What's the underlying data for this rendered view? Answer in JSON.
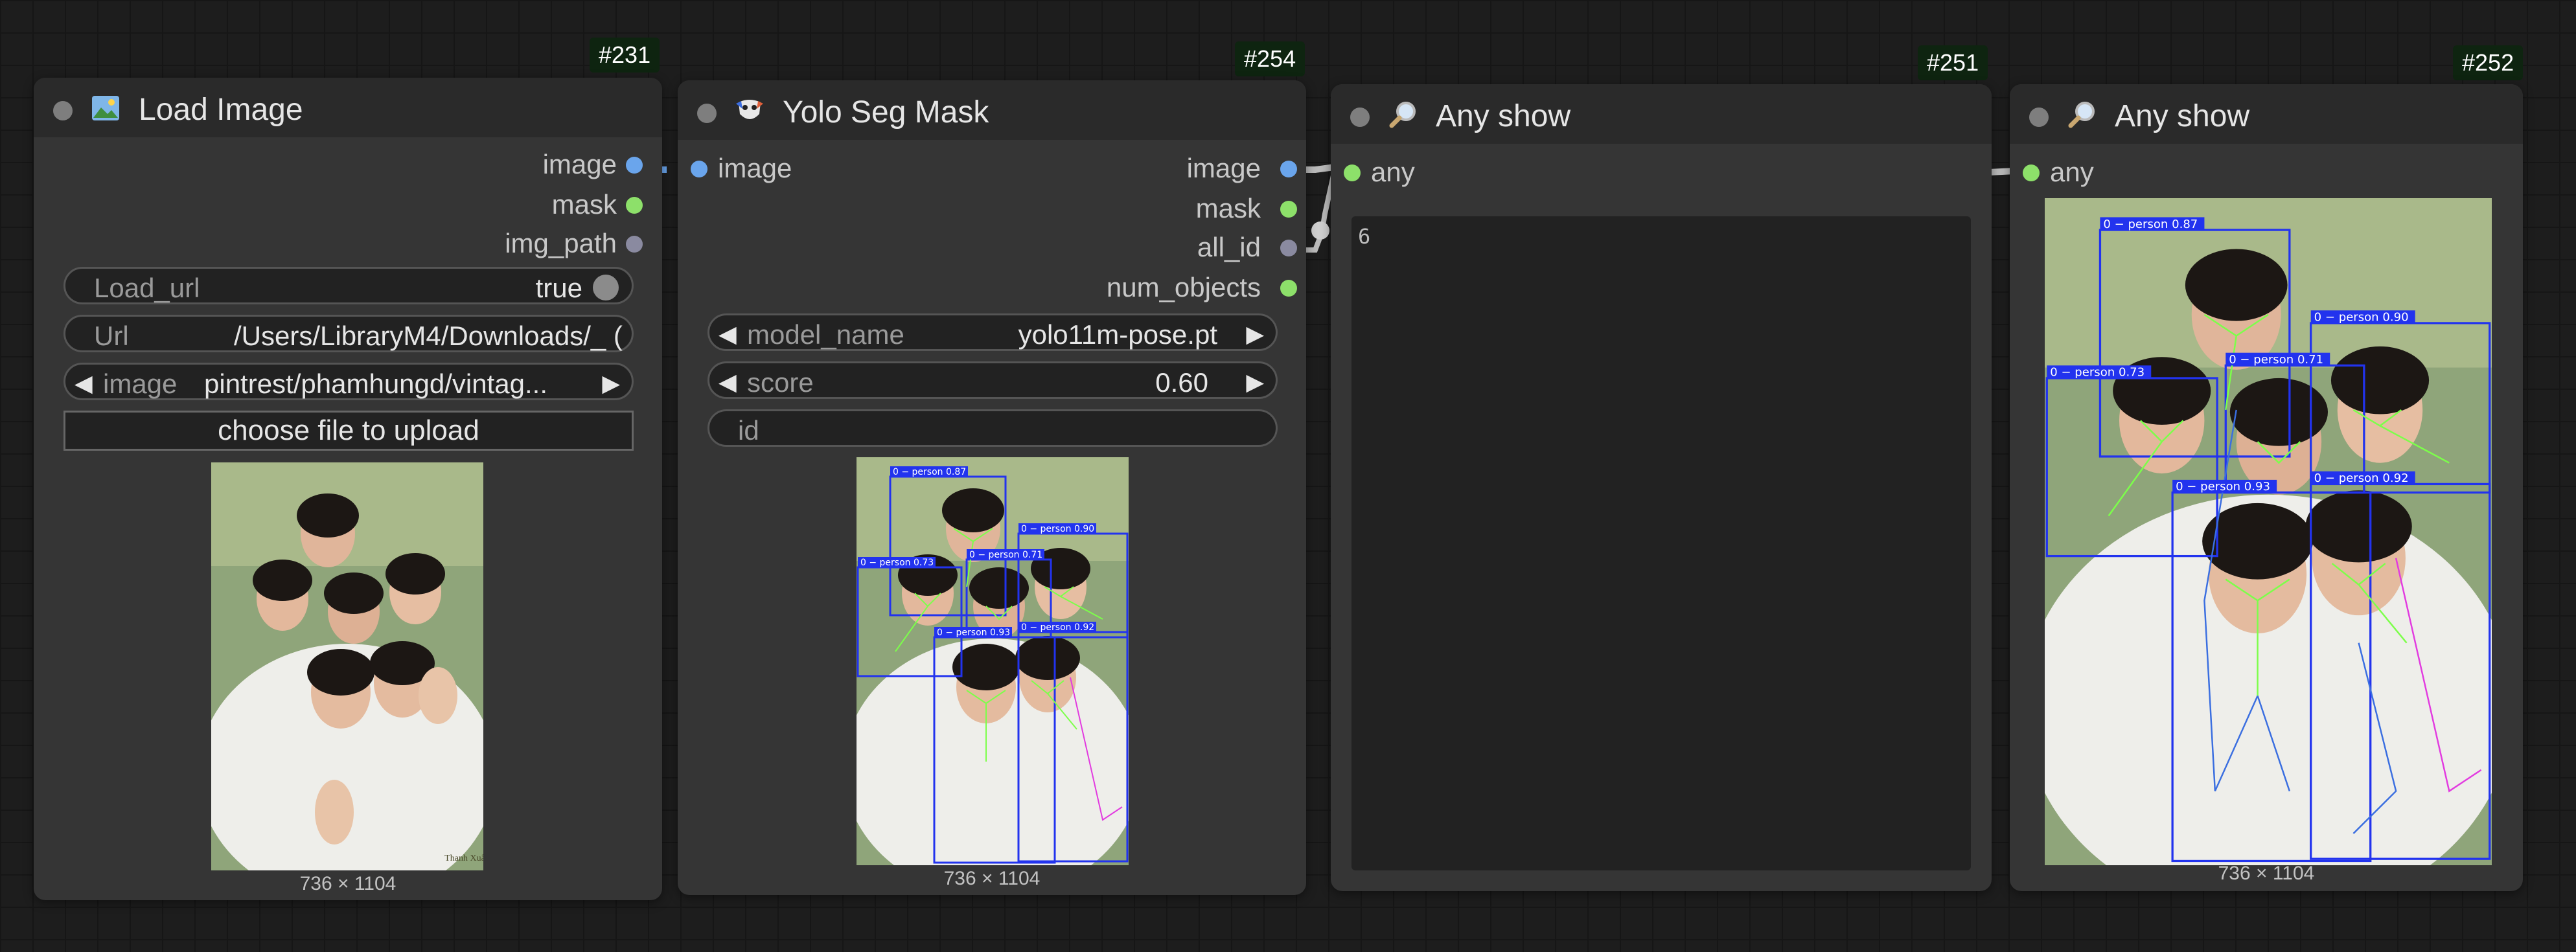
{
  "nodes": {
    "load_image": {
      "id": "#231",
      "title": "Load Image",
      "outputs": [
        "image",
        "mask",
        "img_path"
      ],
      "widgets": {
        "load_url": {
          "name": "Load_url",
          "value": "true"
        },
        "url": {
          "name": "Url",
          "value": "/Users/LibraryM4/Downloads/_ ("
        },
        "image": {
          "name": "image",
          "value": "pintrest/phamhungd/vintag..."
        }
      },
      "upload_button": "choose file to upload",
      "image_size": "736 × 1104"
    },
    "yolo_seg_mask": {
      "id": "#254",
      "title": "Yolo Seg Mask",
      "inputs": [
        "image"
      ],
      "outputs": [
        "image",
        "mask",
        "all_id",
        "num_objects"
      ],
      "widgets": {
        "model_name": {
          "name": "model_name",
          "value": "yolo11m-pose.pt"
        },
        "score": {
          "name": "score",
          "value": "0.60"
        },
        "id": {
          "name": "id",
          "value": ""
        }
      },
      "image_size": "736 × 1104"
    },
    "any_show_251": {
      "id": "#251",
      "title": "Any show",
      "inputs": [
        "any"
      ],
      "text_value": "6"
    },
    "any_show_252": {
      "id": "#252",
      "title": "Any show",
      "inputs": [
        "any"
      ],
      "image_size": "736 × 1104"
    }
  },
  "detections": [
    {
      "label": "0 − person 0.87"
    },
    {
      "label": "0 − person 0.90"
    },
    {
      "label": "0 − person 0.71"
    },
    {
      "label": "0 − person 0.73"
    },
    {
      "label": "0 − person 0.92"
    },
    {
      "label": "0 − person 0.93"
    }
  ],
  "icons": {
    "load_image": "picture-icon",
    "yolo_seg_mask": "mask-icon",
    "any_show": "magnifier-icon"
  },
  "colors": {
    "canvas": "#1d1d1d",
    "node_body": "#353535",
    "node_header": "#2a2a2a",
    "socket_image": "#6aa5ec",
    "socket_mask": "#8de06a",
    "detection_box": "#2233ee",
    "pose_lines": "#7cff4a"
  },
  "watermark": "Thanh Xuân"
}
